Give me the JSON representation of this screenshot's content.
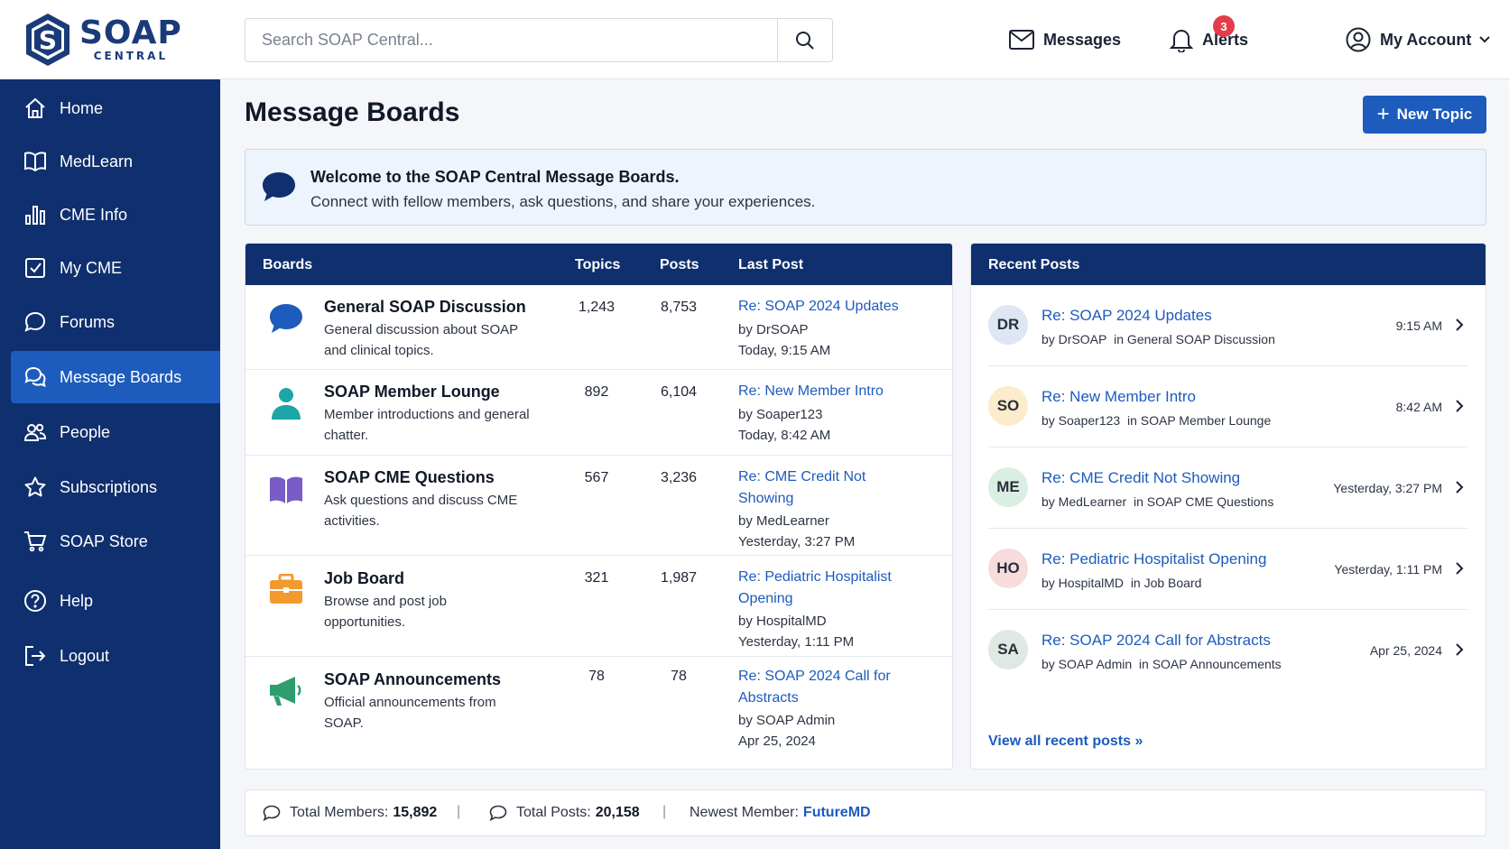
{
  "brand": {
    "name": "SOAP",
    "sub": "CENTRAL"
  },
  "search": {
    "placeholder": "Search SOAP Central..."
  },
  "header": {
    "messages_label": "Messages",
    "alerts_label": "Alerts",
    "alerts_count": "3",
    "account_label": "My Account"
  },
  "sidebar": {
    "items": [
      {
        "label": "Home",
        "icon": "home-icon"
      },
      {
        "label": "MedLearn",
        "icon": "book-icon"
      },
      {
        "label": "CME Info",
        "icon": "bar-chart-icon"
      },
      {
        "label": "My CME",
        "icon": "checkbox-icon"
      },
      {
        "label": "Forums",
        "icon": "chat-bubble-icon"
      },
      {
        "label": "Message Boards",
        "icon": "chat-bubbles-icon",
        "active": true
      },
      {
        "label": "People",
        "icon": "people-icon"
      },
      {
        "label": "Subscriptions",
        "icon": "star-icon"
      },
      {
        "label": "SOAP Store",
        "icon": "cart-icon"
      },
      {
        "label": "Help",
        "icon": "help-icon"
      },
      {
        "label": "Logout",
        "icon": "logout-icon"
      }
    ]
  },
  "main": {
    "title": "Message Boards",
    "new_topic_label": "New Topic",
    "welcome": {
      "title": "Welcome to the SOAP Central Message Boards.",
      "text": "Connect with fellow members, ask questions, and share your experiences."
    }
  },
  "boards": {
    "headers": {
      "boards": "Boards",
      "topics": "Topics",
      "posts": "Posts",
      "last_post": "Last Post"
    },
    "rows": [
      {
        "name": "General SOAP Discussion",
        "desc": "General discussion about SOAP and clinical topics.",
        "topics": "1,243",
        "posts": "8,753",
        "last_title": "Re: SOAP 2024 Updates",
        "last_by": "by DrSOAP",
        "last_time": "Today, 9:15 AM",
        "icon": "speech-bubble-icon",
        "color": "#1d5bbd"
      },
      {
        "name": "SOAP Member Lounge",
        "desc": "Member introductions and general chatter.",
        "topics": "892",
        "posts": "6,104",
        "last_title": "Re: New Member Intro",
        "last_by": "by Soaper123",
        "last_time": "Today, 8:42 AM",
        "icon": "person-icon",
        "color": "#1ca6a8"
      },
      {
        "name": "SOAP CME Questions",
        "desc": "Ask questions and discuss CME activities.",
        "topics": "567",
        "posts": "3,236",
        "last_title": "Re: CME Credit Not Showing",
        "last_by": "by MedLearner",
        "last_time": "Yesterday, 3:27 PM",
        "icon": "open-book-icon",
        "color": "#7a5bc7"
      },
      {
        "name": "Job Board",
        "desc": "Browse and post job opportunities.",
        "topics": "321",
        "posts": "1,987",
        "last_title": "Re: Pediatric Hospitalist Opening",
        "last_by": "by HospitalMD",
        "last_time": "Yesterday, 1:11 PM",
        "icon": "briefcase-icon",
        "color": "#f29a2e"
      },
      {
        "name": "SOAP Announcements",
        "desc": "Official announcements from SOAP.",
        "topics": "78",
        "posts": "78",
        "last_title": "Re: SOAP 2024 Call for Abstracts",
        "last_by": "by SOAP Admin",
        "last_time": "Apr 25, 2024",
        "icon": "megaphone-icon",
        "color": "#2f9e6e"
      }
    ]
  },
  "recent": {
    "title": "Recent Posts",
    "posts": [
      {
        "initials": "DR",
        "title": "Re: SOAP 2024 Updates",
        "by": "by DrSOAP",
        "board": "in General SOAP Discussion",
        "time": "9:15 AM",
        "bg": "#dde6f3"
      },
      {
        "initials": "SO",
        "title": "Re: New Member Intro",
        "by": "by Soaper123",
        "board": "in SOAP Member Lounge",
        "time": "8:42 AM",
        "bg": "#fbeccb"
      },
      {
        "initials": "ME",
        "title": "Re: CME Credit Not Showing",
        "by": "by MedLearner",
        "board": "in SOAP CME Questions",
        "time": "Yesterday, 3:27 PM",
        "bg": "#d9efe3"
      },
      {
        "initials": "HO",
        "title": "Re: Pediatric Hospitalist Opening",
        "by": "by HospitalMD",
        "board": "in Job Board",
        "time": "Yesterday, 1:11 PM",
        "bg": "#f7dcdc"
      },
      {
        "initials": "SA",
        "title": "Re: SOAP 2024 Call for Abstracts",
        "by": "by SOAP Admin",
        "board": "in SOAP Announcements",
        "time": "Apr 25, 2024",
        "bg": "#dfe8e2"
      }
    ],
    "view_all": "View all recent posts »"
  },
  "stats": {
    "members_label": "Total Members:",
    "members_value": "15,892",
    "posts_label": "Total Posts:",
    "posts_value": "20,158",
    "newest_label": "Newest Member:",
    "newest_value": "FutureMD",
    "separator": "|"
  }
}
